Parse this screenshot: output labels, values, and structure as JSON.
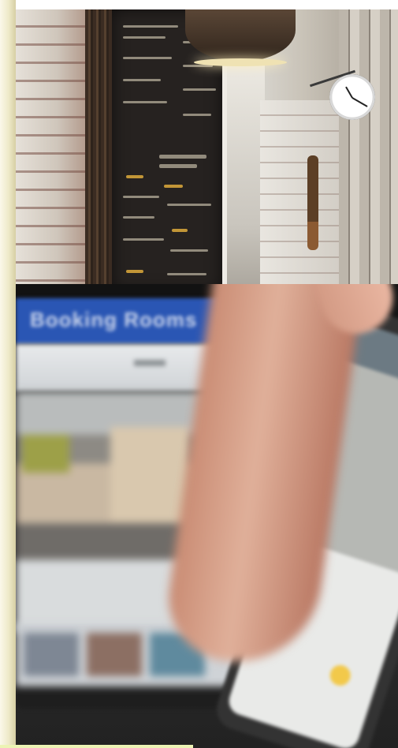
{
  "scene": {
    "description_tags": [
      "cafe-interior",
      "chalkboard-menu",
      "wall-clock",
      "pendant-lamp",
      "tablet-browser",
      "hand-holding-phone"
    ]
  },
  "tablet": {
    "header_title": "Booking Rooms"
  },
  "colors": {
    "site_header": "#2a56b4",
    "left_strip": "#eee9c8",
    "phone_button": "#f2c94a"
  }
}
